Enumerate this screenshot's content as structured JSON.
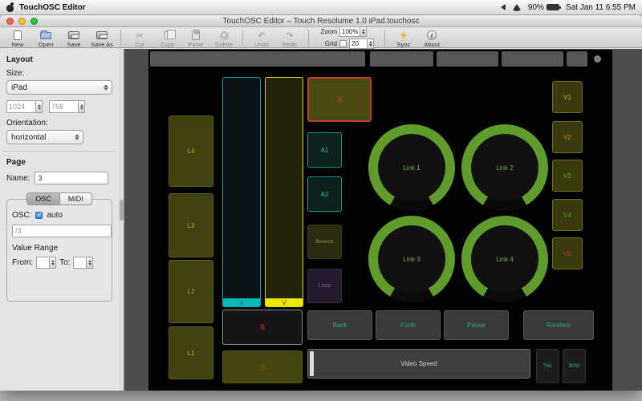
{
  "menu_bar": {
    "app_name": "TouchOSC Editor",
    "battery": "90%",
    "clock": "Sat Jan 11 6:55 PM"
  },
  "window": {
    "title": "TouchOSC Editor – Touch Resolume 1.0 iPad.touchosc"
  },
  "toolbar": {
    "new": "New",
    "open": "Open",
    "save": "Save",
    "save_as": "Save As",
    "cut": "Cut",
    "copy": "Copy",
    "paste": "Paste",
    "delete": "Delete",
    "undo": "Undo",
    "redo": "Redo",
    "zoom_label": "Zoom",
    "zoom_value": "100%",
    "grid_label": "Grid",
    "grid_value": "20",
    "sync": "Sync",
    "about": "About"
  },
  "sidebar": {
    "layout_header": "Layout",
    "size_label": "Size:",
    "size_value": "iPad",
    "width_value": "1024",
    "height_value": "768",
    "orientation_label": "Orientation:",
    "orientation_value": "horizontal",
    "page_header": "Page",
    "name_label": "Name:",
    "name_value": "3",
    "tab_osc": "OSC",
    "tab_midi": "MIDI",
    "osc_label": "OSC:",
    "auto_label": "auto",
    "osc_address": "/3",
    "value_range_label": "Value Range",
    "from_label": "From:",
    "to_label": "To:"
  },
  "canvas": {
    "left_buttons": [
      {
        "label": "L4"
      },
      {
        "label": "L3"
      },
      {
        "label": "L2"
      },
      {
        "label": "L1"
      }
    ],
    "fader_x": {
      "label": "x"
    },
    "fader_v": {
      "label": "V"
    },
    "x_button": {
      "label": "X"
    },
    "a1_button": {
      "label": "A1"
    },
    "a2_button": {
      "label": "A2"
    },
    "bounce_button": {
      "label": "Bounce"
    },
    "loop_button": {
      "label": "Loop"
    },
    "knobs": [
      {
        "label": "Link 1"
      },
      {
        "label": "Link 2"
      },
      {
        "label": "Link 3"
      },
      {
        "label": "Link 4"
      }
    ],
    "v_buttons": [
      {
        "label": "V1"
      },
      {
        "label": "V2"
      },
      {
        "label": "V3"
      },
      {
        "label": "V4"
      },
      {
        "label": "V5"
      }
    ],
    "b_button": {
      "label": "B"
    },
    "transport_buttons": [
      {
        "label": "Back"
      },
      {
        "label": "Forth"
      },
      {
        "label": "Pause"
      },
      {
        "label": "Random"
      }
    ],
    "s_button": {
      "label": "S"
    },
    "video_speed": {
      "label": "Video Speed"
    },
    "tml_button": {
      "label": "TML"
    },
    "bpm_button": {
      "label": "BPM"
    }
  },
  "colors": {
    "accent_cyan": "#00b9b9",
    "accent_yellow": "#e9e900",
    "accent_red": "#c23b2c",
    "accent_teal": "#27c2b2",
    "knob_green": "#5f9c2c",
    "olive_text": "#9cba21",
    "orange_text": "#c77d14",
    "sync_bolt": "#eebc1d"
  }
}
